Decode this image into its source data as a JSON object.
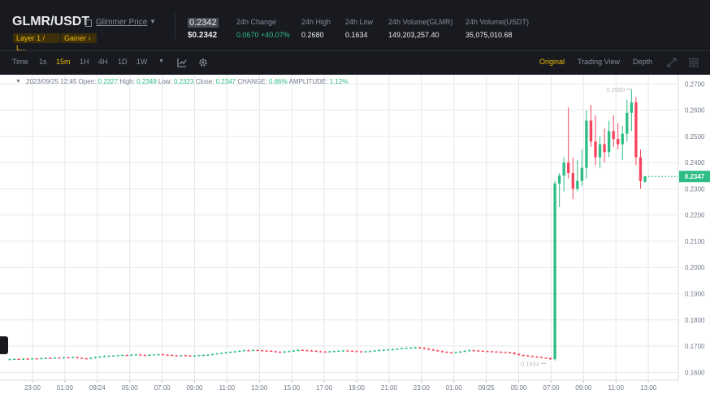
{
  "header": {
    "pair": "GLMR/USDT",
    "source": "Glimmer Price",
    "tags": [
      "Layer 1 / L...",
      "Gainer ›"
    ],
    "last_price": "0.2342",
    "last_price_usd": "$0.2342",
    "stats": [
      {
        "label": "24h Change",
        "value": "0.0670 +40.07%"
      },
      {
        "label": "24h High",
        "value": "0.2680"
      },
      {
        "label": "24h Low",
        "value": "0.1634"
      },
      {
        "label": "24h Volume(GLMR)",
        "value": "149,203,257.40"
      },
      {
        "label": "24h Volume(USDT)",
        "value": "35,075,010.68"
      }
    ],
    "colors": {
      "bg": "#181a20",
      "accent": "#f0b90b",
      "up": "#2ebd85",
      "down": "#f6465d"
    }
  },
  "toolbar": {
    "intervals": [
      "Time",
      "1s",
      "15m",
      "1H",
      "4H",
      "1D",
      "1W"
    ],
    "active_interval": "15m",
    "views": [
      "Original",
      "Trading View",
      "Depth"
    ],
    "active_view": "Original",
    "icons": [
      "indicator-icon",
      "settings-icon",
      "expand-icon",
      "grid-layout-icon"
    ]
  },
  "ohlc": {
    "date": "2023/09/25 12:45",
    "open_label": "Open:",
    "open": "0.2327",
    "high_label": "High:",
    "high": "0.2349",
    "low_label": "Low:",
    "low": "0.2323",
    "close_label": "Close:",
    "close": "0.2347",
    "change_label": "CHANGE:",
    "change": "0.86%",
    "amp_label": "AMPLITUDE:",
    "amp": "1.12%"
  },
  "chart_data": {
    "type": "candlestick",
    "x_ticks": [
      "23:00",
      "01:00",
      "09/24",
      "05:00",
      "07:00",
      "09:00",
      "11:00",
      "13:00",
      "15:00",
      "17:00",
      "19:00",
      "21:00",
      "23:00",
      "01:00",
      "09/25",
      "05:00",
      "07:00",
      "09:00",
      "11:00",
      "13:00"
    ],
    "y_ticks": [
      "0.2700",
      "0.2600",
      "0.2500",
      "0.2400",
      "0.2300",
      "0.2200",
      "0.2100",
      "0.2000",
      "0.1900",
      "0.1800",
      "0.1700",
      "0.1600"
    ],
    "ylim": [
      0.157,
      0.2735
    ],
    "current_price": "0.2347",
    "high_marker": "0.2680",
    "low_marker": "0.1634",
    "flat_closes": [
      0.165,
      0.1651,
      0.165,
      0.1652,
      0.1651,
      0.1653,
      0.1652,
      0.1654,
      0.1655,
      0.1654,
      0.1656,
      0.1655,
      0.1657,
      0.1656,
      0.1658,
      0.1655,
      0.1653,
      0.1652,
      0.1655,
      0.1658,
      0.166,
      0.1662,
      0.1663,
      0.1664,
      0.1665,
      0.1666,
      0.1665,
      0.1667,
      0.1668,
      0.1666,
      0.1665,
      0.1667,
      0.1668,
      0.1669,
      0.1667,
      0.1666,
      0.1664,
      0.1663,
      0.1665,
      0.1664,
      0.1663,
      0.1664,
      0.1665,
      0.1666,
      0.1667,
      0.167,
      0.1672,
      0.1674,
      0.1676,
      0.1678,
      0.168,
      0.1682,
      0.1684,
      0.1683,
      0.1685,
      0.1684,
      0.1683,
      0.1682,
      0.168,
      0.1678,
      0.1677,
      0.1679,
      0.1681,
      0.1683,
      0.1685,
      0.1684,
      0.1683,
      0.1682,
      0.168,
      0.1679,
      0.1678,
      0.168,
      0.1681,
      0.1682,
      0.1683,
      0.1682,
      0.1681,
      0.168,
      0.1679,
      0.168,
      0.1681,
      0.1683,
      0.1685,
      0.1686,
      0.1687,
      0.1688,
      0.169,
      0.1692,
      0.1693,
      0.1694,
      0.1695,
      0.1693,
      0.169,
      0.1687,
      0.1684,
      0.1681,
      0.1678,
      0.1676,
      0.1675,
      0.1677,
      0.1679,
      0.1682,
      0.1684,
      0.1683,
      0.1682,
      0.1681,
      0.168,
      0.1679,
      0.1678,
      0.1677,
      0.1676,
      0.1675,
      0.167,
      0.1666,
      0.1664,
      0.1662,
      0.166,
      0.1658,
      0.1656,
      0.1654,
      0.165
    ],
    "spike": [
      {
        "o": 0.165,
        "h": 0.233,
        "l": 0.1645,
        "c": 0.232
      },
      {
        "o": 0.232,
        "h": 0.236,
        "l": 0.223,
        "c": 0.235
      },
      {
        "o": 0.235,
        "h": 0.242,
        "l": 0.229,
        "c": 0.24
      },
      {
        "o": 0.24,
        "h": 0.261,
        "l": 0.234,
        "c": 0.236
      },
      {
        "o": 0.236,
        "h": 0.242,
        "l": 0.226,
        "c": 0.23
      },
      {
        "o": 0.23,
        "h": 0.241,
        "l": 0.229,
        "c": 0.233
      },
      {
        "o": 0.233,
        "h": 0.245,
        "l": 0.231,
        "c": 0.238
      },
      {
        "o": 0.238,
        "h": 0.26,
        "l": 0.234,
        "c": 0.256
      },
      {
        "o": 0.256,
        "h": 0.262,
        "l": 0.246,
        "c": 0.248
      },
      {
        "o": 0.248,
        "h": 0.258,
        "l": 0.239,
        "c": 0.242
      },
      {
        "o": 0.242,
        "h": 0.25,
        "l": 0.238,
        "c": 0.247
      },
      {
        "o": 0.247,
        "h": 0.253,
        "l": 0.24,
        "c": 0.244
      },
      {
        "o": 0.244,
        "h": 0.256,
        "l": 0.242,
        "c": 0.252
      },
      {
        "o": 0.252,
        "h": 0.258,
        "l": 0.246,
        "c": 0.249
      },
      {
        "o": 0.249,
        "h": 0.255,
        "l": 0.245,
        "c": 0.247
      },
      {
        "o": 0.247,
        "h": 0.254,
        "l": 0.241,
        "c": 0.251
      },
      {
        "o": 0.251,
        "h": 0.264,
        "l": 0.248,
        "c": 0.259
      },
      {
        "o": 0.259,
        "h": 0.268,
        "l": 0.252,
        "c": 0.263
      },
      {
        "o": 0.263,
        "h": 0.265,
        "l": 0.239,
        "c": 0.242
      },
      {
        "o": 0.242,
        "h": 0.245,
        "l": 0.23,
        "c": 0.233
      },
      {
        "o": 0.2327,
        "h": 0.2349,
        "l": 0.2323,
        "c": 0.2347
      }
    ]
  }
}
